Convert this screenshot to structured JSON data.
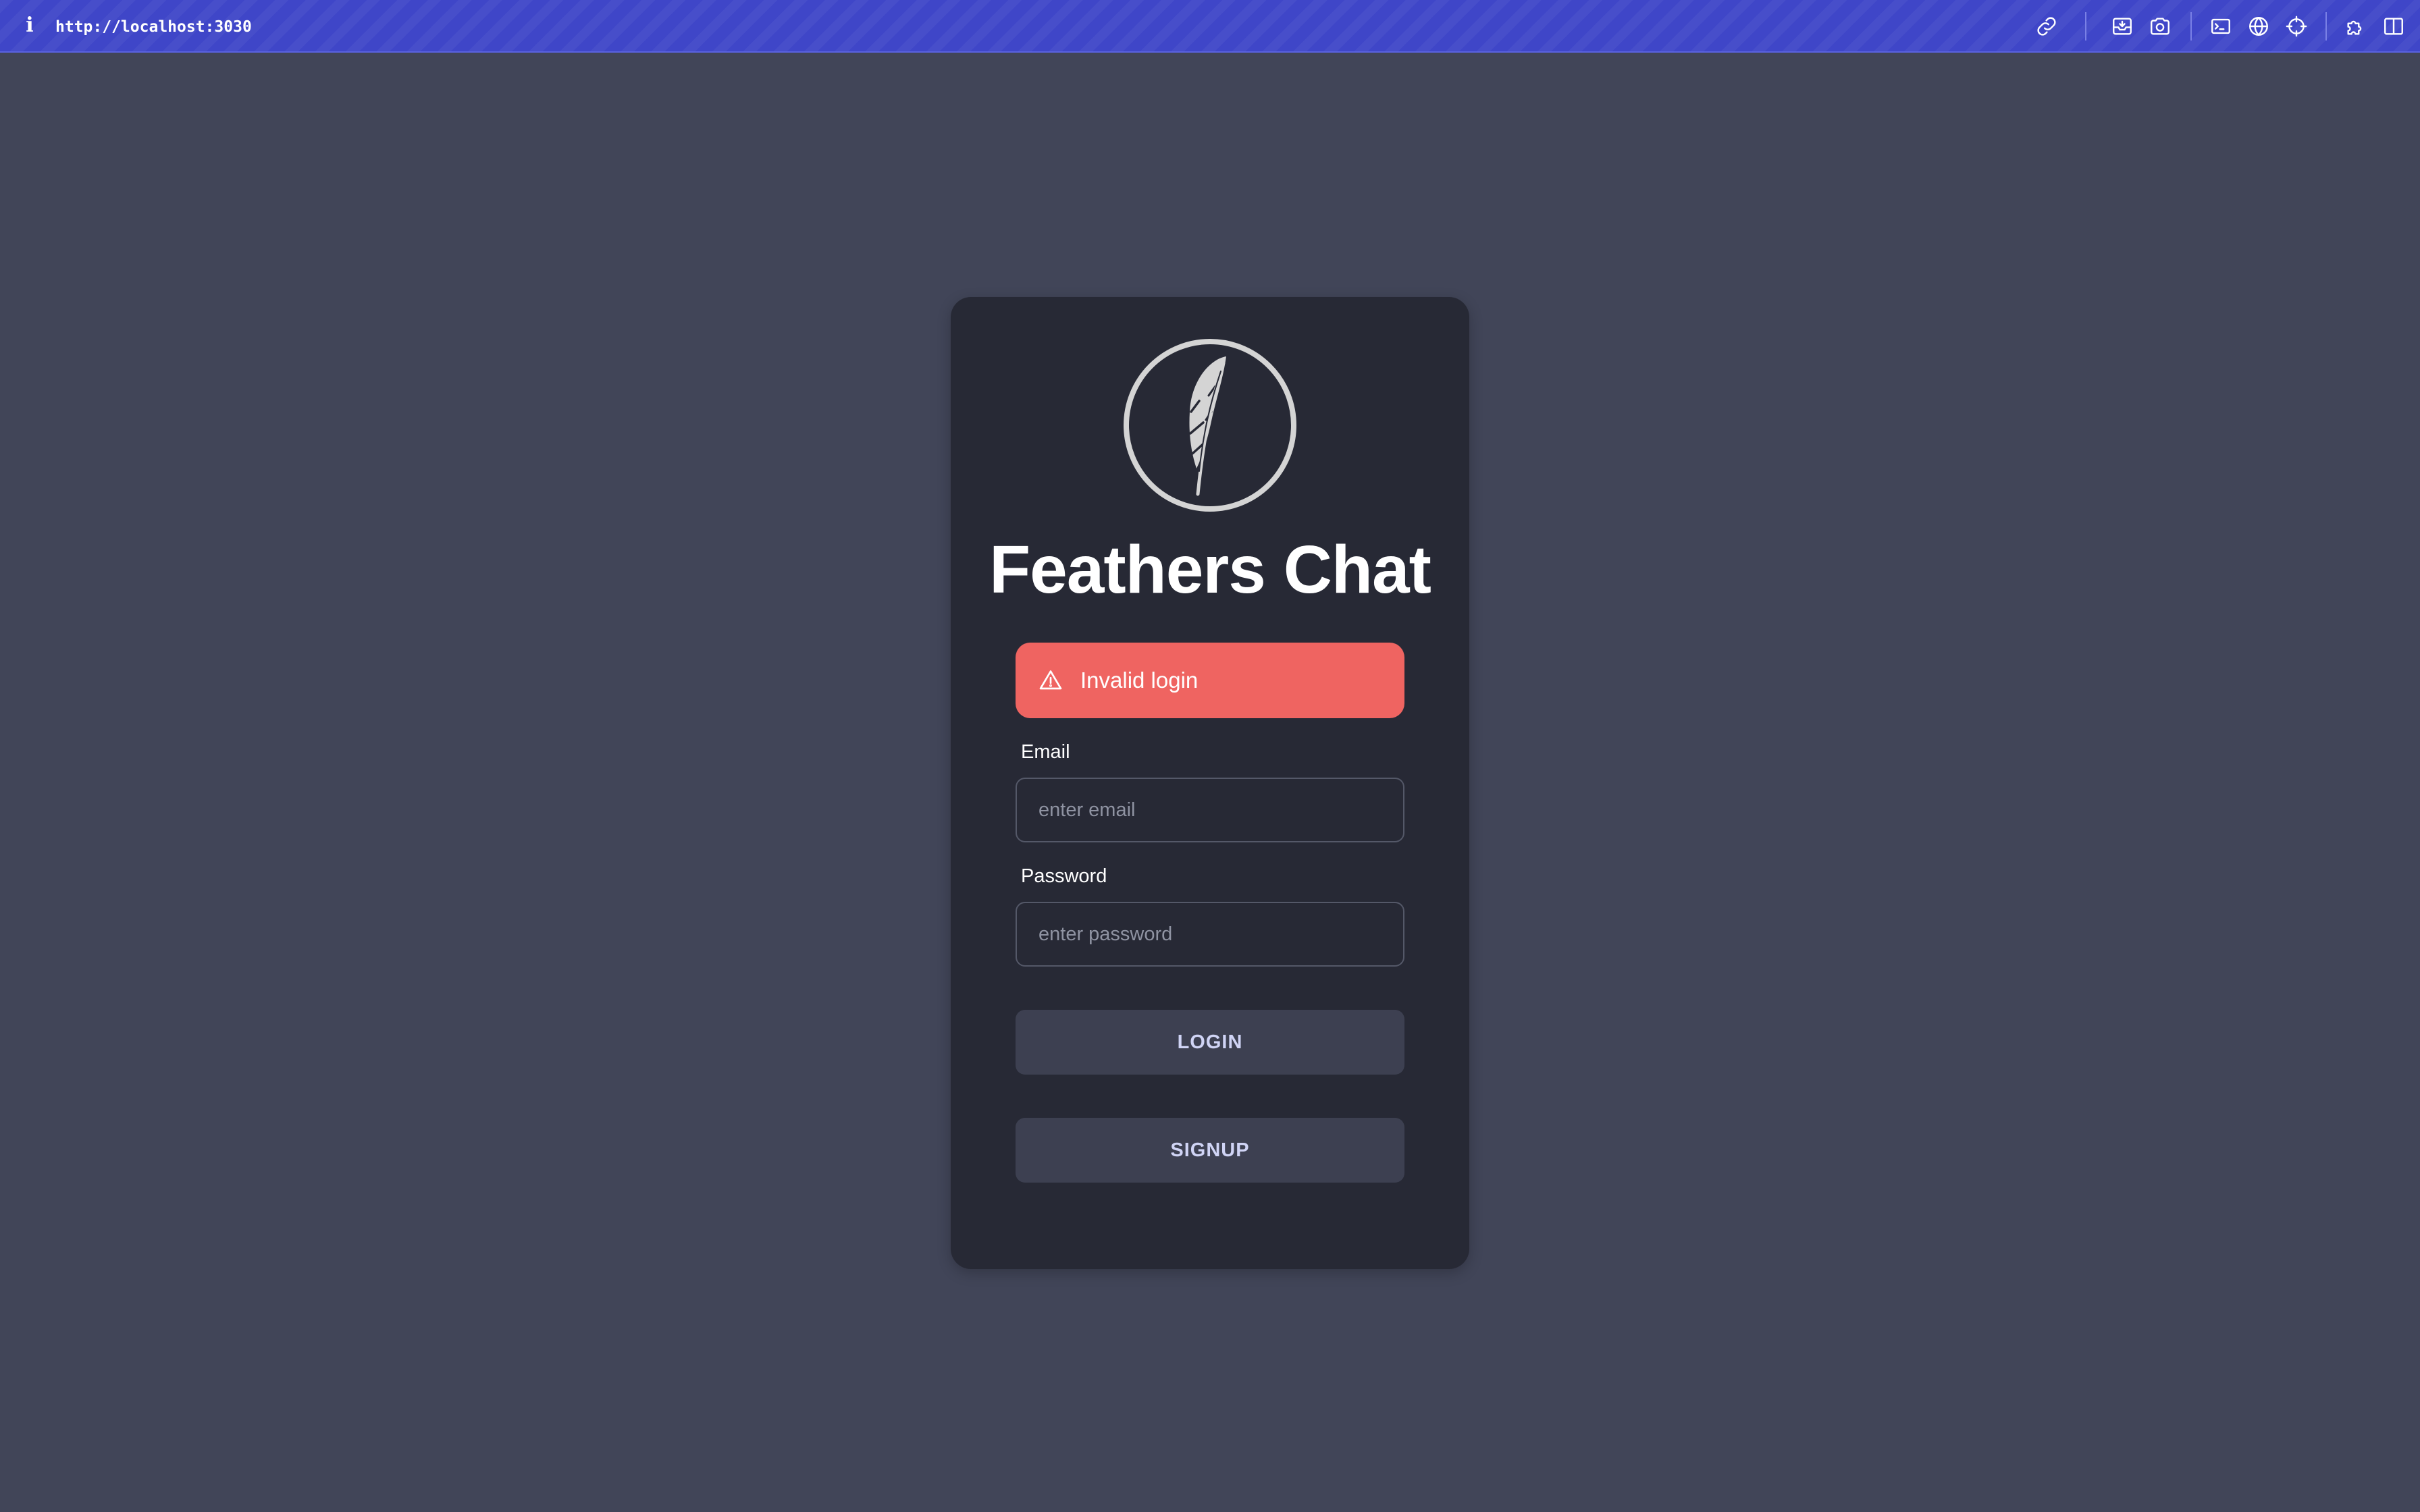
{
  "browser": {
    "info_icon": "i",
    "url": "http://localhost:3030",
    "toolbar_icons": [
      "link-icon",
      "inbox-tray-icon",
      "camera-icon",
      "terminal-icon",
      "globe-icon",
      "crosshair-icon",
      "puzzle-icon",
      "split-view-icon"
    ]
  },
  "login": {
    "logo_icon": "feather-icon",
    "title": "Feathers Chat",
    "alert": {
      "icon": "warning-triangle-icon",
      "message": "Invalid login"
    },
    "email": {
      "label": "Email",
      "placeholder": "enter email",
      "value": ""
    },
    "password": {
      "label": "Password",
      "placeholder": "enter password",
      "value": ""
    },
    "login_label": "LOGIN",
    "signup_label": "SIGNUP"
  },
  "colors": {
    "page_background": "#414558",
    "toolbar": "#3f46c8",
    "card": "#272935",
    "alert": "#ef6461",
    "button": "#3d4051",
    "button_text": "#d0d4f5"
  }
}
